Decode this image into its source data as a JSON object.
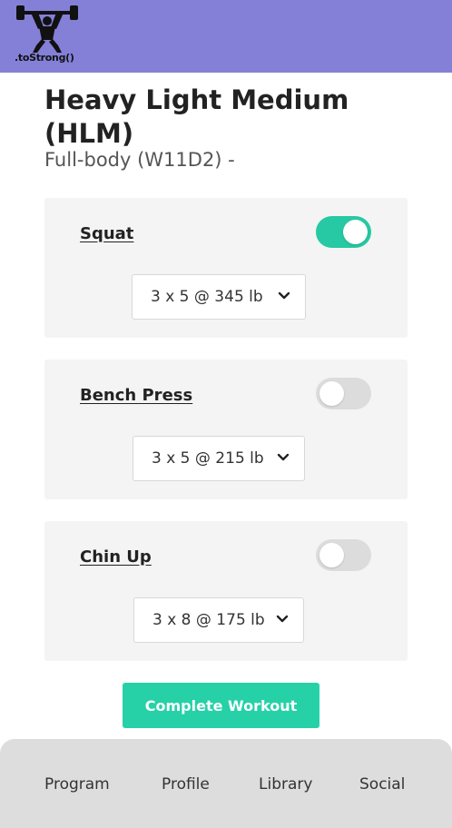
{
  "header": {
    "logo_icon": "weightlifter-icon",
    "logo_text": ".toStrong()",
    "background": "#8480d8"
  },
  "workout": {
    "title": "Heavy Light Medium (HLM)",
    "subtitle": "Full-body (W11D2) -"
  },
  "exercises": [
    {
      "name": "Squat",
      "enabled": true,
      "selected": "3 x 5 @ 345 lb"
    },
    {
      "name": "Bench Press",
      "enabled": false,
      "selected": "3 x 5 @ 215 lb"
    },
    {
      "name": "Chin Up",
      "enabled": false,
      "selected": "3 x 8 @ 175 lb"
    }
  ],
  "actions": {
    "complete_label": "Complete Workout"
  },
  "nav": {
    "items": [
      "Program",
      "Profile",
      "Library",
      "Social"
    ]
  },
  "colors": {
    "accent": "#26d1a8",
    "toggle_on": "#26c9a3",
    "toggle_off": "#dcdcdc",
    "card": "#f4f4f4",
    "footer": "#dddddd"
  }
}
